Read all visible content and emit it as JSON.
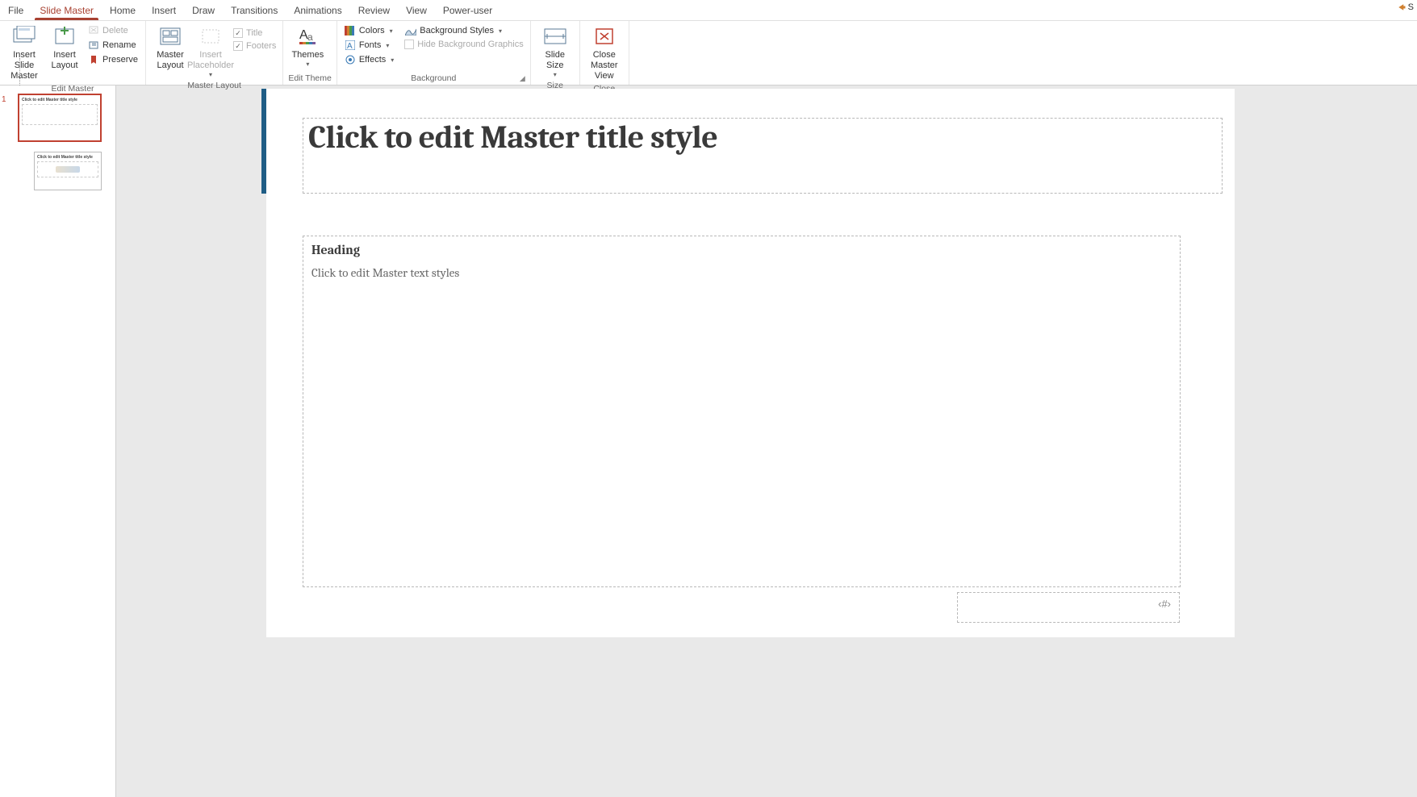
{
  "tabs": {
    "file": "File",
    "slide_master": "Slide Master",
    "home": "Home",
    "insert": "Insert",
    "draw": "Draw",
    "transitions": "Transitions",
    "animations": "Animations",
    "review": "Review",
    "view": "View",
    "power_user": "Power-user"
  },
  "share": "S",
  "ribbon": {
    "edit_master": {
      "label": "Edit Master",
      "insert_slide_master": "Insert Slide Master",
      "insert_layout": "Insert Layout",
      "delete": "Delete",
      "rename": "Rename",
      "preserve": "Preserve"
    },
    "master_layout": {
      "label": "Master Layout",
      "master_layout_btn": "Master Layout",
      "insert_placeholder": "Insert Placeholder",
      "title_chk": "Title",
      "footers_chk": "Footers"
    },
    "edit_theme": {
      "label": "Edit Theme",
      "themes": "Themes"
    },
    "background": {
      "label": "Background",
      "colors": "Colors",
      "fonts": "Fonts",
      "effects": "Effects",
      "background_styles": "Background Styles",
      "hide_bg": "Hide Background Graphics"
    },
    "size": {
      "label": "Size",
      "slide_size": "Slide Size"
    },
    "close": {
      "label": "Close",
      "close_master": "Close Master View"
    }
  },
  "thumbs": {
    "index": "1",
    "master_title": "Click to edit Master title style",
    "layout_title": "Click to edit Master title style"
  },
  "slide": {
    "title": "Click to edit Master title style",
    "body_heading": "Heading",
    "body_text": "Click to edit Master text styles",
    "page_num": "‹#›"
  }
}
